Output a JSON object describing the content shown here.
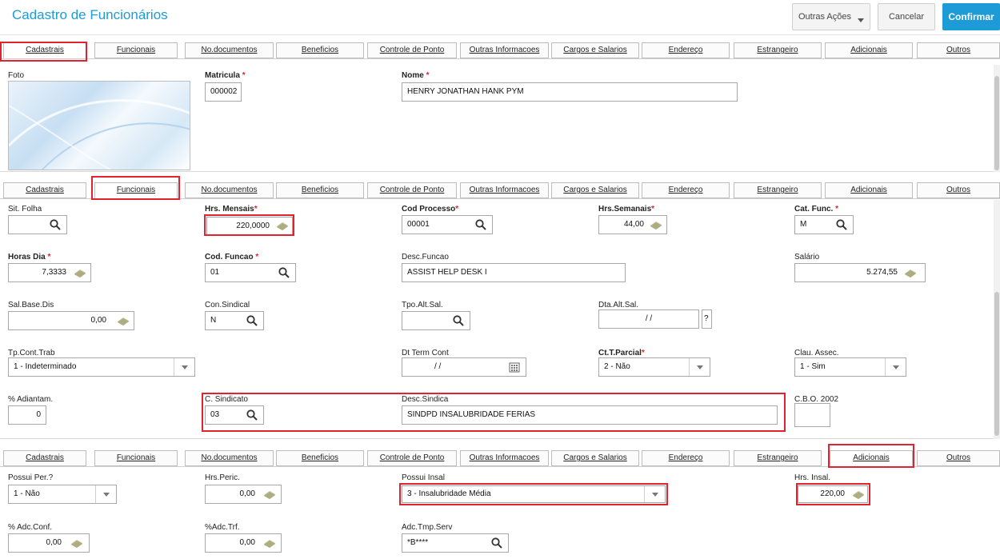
{
  "header": {
    "title": "Cadastro de Funcionários",
    "buttons": {
      "more": "Outras Ações",
      "cancel": "Cancelar",
      "confirm": "Confirmar"
    }
  },
  "tabs": [
    "Cadastrais",
    "Funcionais",
    "No.documentos",
    "Beneficios",
    "Controle de Ponto",
    "Outras Informacoes",
    "Cargos e Salarios",
    "Endereço",
    "Estrangeiro",
    "Adicionais",
    "Outros"
  ],
  "cadastrais": {
    "foto_label": "Foto",
    "matricula": {
      "label": "Matricula",
      "req": "*",
      "value": "000002"
    },
    "nome": {
      "label": "Nome",
      "req": "*",
      "value": "HENRY JONATHAN HANK PYM"
    }
  },
  "funcionais": {
    "sit_folha": {
      "label": "Sit. Folha",
      "value": ""
    },
    "hrs_mensais": {
      "label": "Hrs. Mensais",
      "req": "*",
      "value": "220,0000"
    },
    "cod_processo": {
      "label": "Cod Processo",
      "req": "*",
      "value": "00001"
    },
    "hrs_semanais": {
      "label": "Hrs.Semanais",
      "req": "*",
      "value": "44,00"
    },
    "cat_func": {
      "label": "Cat. Func.",
      "req": "*",
      "value": "M"
    },
    "horas_dia": {
      "label": "Horas Dia",
      "req": "*",
      "value": "7,3333"
    },
    "cod_funcao": {
      "label": "Cod. Funcao",
      "req": "*",
      "value": "01"
    },
    "desc_funcao": {
      "label": "Desc.Funcao",
      "value": "ASSIST HELP DESK I"
    },
    "salario": {
      "label": "Salário",
      "value": "5.274,55"
    },
    "sal_base_dis": {
      "label": "Sal.Base.Dis",
      "value": "0,00"
    },
    "con_sindical": {
      "label": "Con.Sindical",
      "value": "N"
    },
    "tpo_alt_sal": {
      "label": "Tpo.Alt.Sal.",
      "value": ""
    },
    "dta_alt_sal": {
      "label": "Dta.Alt.Sal.",
      "value": "/ /",
      "help": "?"
    },
    "tp_cont_trab": {
      "label": "Tp.Cont.Trab",
      "value": "1 - Indeterminado"
    },
    "dt_term_cont": {
      "label": "Dt Term Cont",
      "value": "/ /"
    },
    "ct_parcial": {
      "label": "Ct.T.Parcial",
      "req": "*",
      "value": "2 - Não"
    },
    "clau_assec": {
      "label": "Clau. Assec.",
      "value": "1 - Sim"
    },
    "pct_adiantam": {
      "label": "% Adiantam.",
      "value": "0"
    },
    "c_sindicato": {
      "label": "C. Sindicato",
      "value": "03"
    },
    "desc_sindica": {
      "label": "Desc.Sindica",
      "value": "SINDPD INSALUBRIDADE FERIAS"
    },
    "cbo": {
      "label": "C.B.O. 2002",
      "value": ""
    }
  },
  "adicionais": {
    "possui_per": {
      "label": "Possui Per.?",
      "value": "1 - Não"
    },
    "hrs_peric": {
      "label": "Hrs.Peric.",
      "value": "0,00"
    },
    "possui_insal": {
      "label": "Possui Insal",
      "value": "3 - Insalubridade Média"
    },
    "hrs_insal": {
      "label": "Hrs. Insal.",
      "value": "220,00"
    },
    "adc_conf": {
      "label": "% Adc.Conf.",
      "value": "0,00"
    },
    "adc_trf": {
      "label": "%Adc.Trf.",
      "value": "0,00"
    },
    "adc_tmp_serv": {
      "label": "Adc.Tmp.Serv",
      "value": "*B****"
    }
  },
  "colors": {
    "accent": "#1d9bd6",
    "highlight": "#e0232f"
  },
  "icons": [
    "search-icon",
    "calculator-icon",
    "calendar-icon",
    "dropdown-arrow-icon"
  ]
}
